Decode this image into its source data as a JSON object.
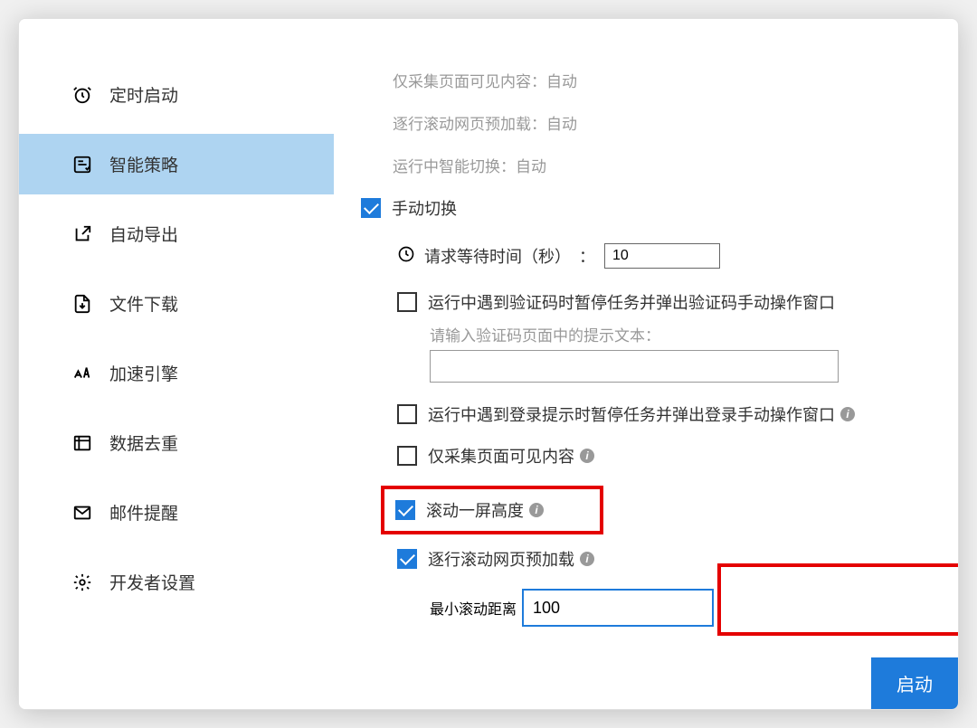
{
  "sidebar": {
    "items": [
      {
        "label": "定时启动"
      },
      {
        "label": "智能策略"
      },
      {
        "label": "自动导出"
      },
      {
        "label": "文件下载"
      },
      {
        "label": "加速引擎"
      },
      {
        "label": "数据去重"
      },
      {
        "label": "邮件提醒"
      },
      {
        "label": "开发者设置"
      }
    ]
  },
  "content": {
    "info_rows": {
      "row1": "仅采集页面可见内容：自动",
      "row2": "逐行滚动网页预加载：自动",
      "row3": "运行中智能切换：自动"
    },
    "manual_switch": "手动切换",
    "wait_time_label": "请求等待时间（秒）　：",
    "wait_time_value": "10",
    "captcha_label": "运行中遇到验证码时暂停任务并弹出验证码手动操作窗口",
    "captcha_hint": "请输入验证码页面中的提示文本：",
    "captcha_input": "",
    "login_label": "运行中遇到登录提示时暂停任务并弹出登录手动操作窗口",
    "visible_only_label": "仅采集页面可见内容",
    "scroll_screen_label": "滚动一屏高度",
    "scroll_preload_label": "逐行滚动网页预加载",
    "min_scroll_label": "最小滚动距离",
    "min_scroll_value": "100"
  },
  "start_button": "启动"
}
